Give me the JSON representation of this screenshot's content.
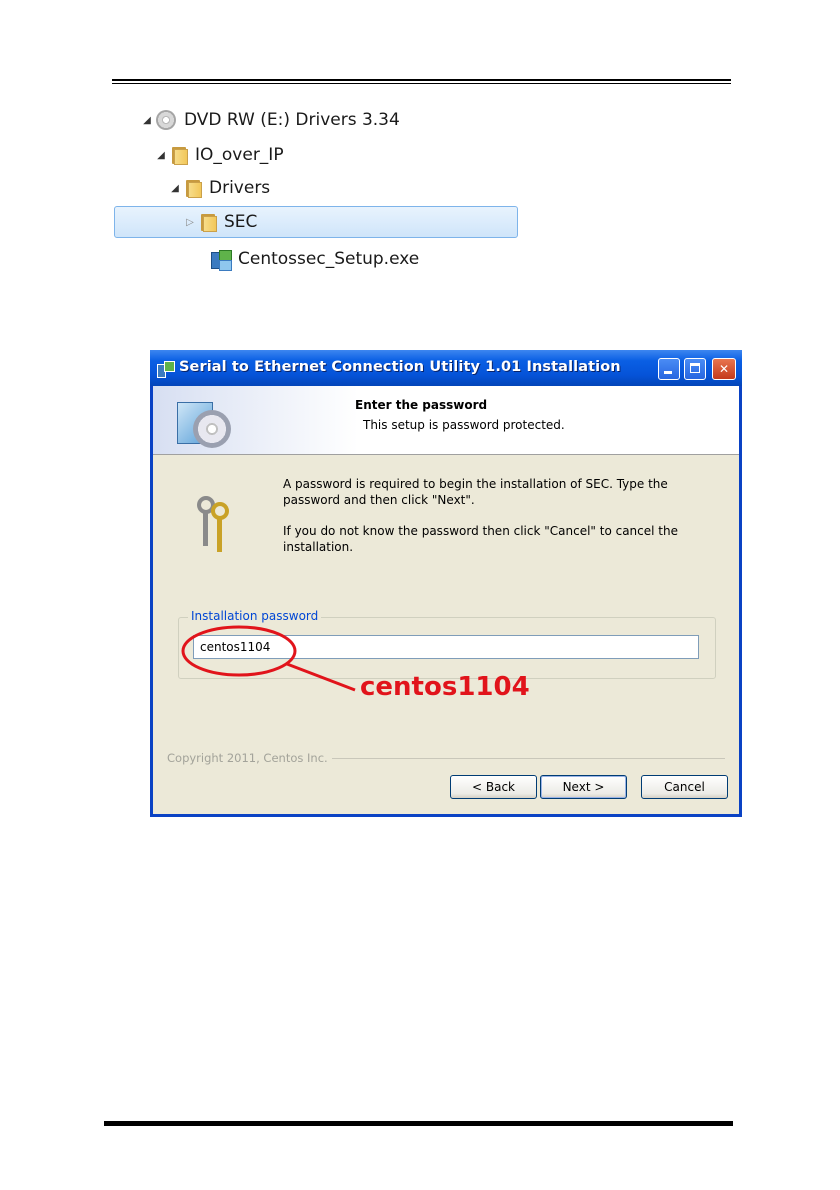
{
  "explorer": {
    "drive_label": "DVD RW (E:) Drivers 3.34",
    "folder_1": "IO_over_IP",
    "folder_2": "Drivers",
    "folder_3": "SEC",
    "file": "Centossec_Setup.exe"
  },
  "dialog": {
    "title": "Serial to Ethernet Connection Utility 1.01 Installation",
    "banner_title": "Enter the password",
    "banner_subtitle": "This setup is password protected.",
    "message_1": "A password is required to begin the installation of SEC. Type the password and then click \"Next\".",
    "message_2": "If you do not know the password then click \"Cancel\" to cancel the installation.",
    "group_label": "Installation password",
    "password_value": "centos1104",
    "copyright": "Copyright 2011, Centos Inc.",
    "buttons": {
      "back": "< Back",
      "next": "Next >",
      "cancel": "Cancel"
    }
  },
  "annotation": {
    "callout_text": "centos1104",
    "color": "#e1141b"
  },
  "icons": [
    "disc-icon",
    "folder-icon",
    "setup-exe-icon",
    "installer-box-icon",
    "keys-icon",
    "minimize-icon",
    "maximize-icon",
    "close-icon"
  ]
}
